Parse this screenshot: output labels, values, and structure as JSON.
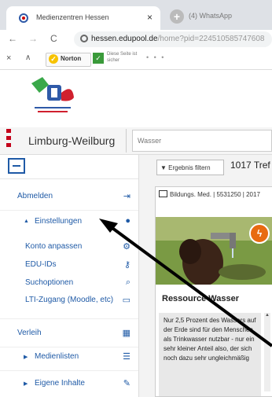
{
  "browser": {
    "tab_title": "Medienzentren Hessen",
    "tab_close": "×",
    "tab2_title": "(4) WhatsApp",
    "url_host": "hessen.edupool.de",
    "url_path": "/home?pid=224510585747608",
    "nav_back": "←",
    "nav_forward": "→",
    "nav_reload": "C"
  },
  "extensions": {
    "close": "×",
    "up": "∧",
    "norton_label": "Norton",
    "safeweb_text": "Diese Seite ist sicher",
    "dots": "• • •"
  },
  "header": {
    "region": "Limburg-Weilburg",
    "search_value": "Wasser"
  },
  "sidebar": {
    "items": [
      {
        "label": "Abmelden",
        "icon": "logout-icon"
      },
      {
        "label": "Einstellungen",
        "icon": "user-icon"
      },
      {
        "label": "Konto anpassen",
        "icon": "gear-icon"
      },
      {
        "label": "EDU-IDs",
        "icon": "key-icon"
      },
      {
        "label": "Suchoptionen",
        "icon": "search-icon"
      },
      {
        "label": "LTI-Zugang (Moodle, etc)",
        "icon": "monitor-icon"
      },
      {
        "label": "Verleih",
        "icon": "calendar-icon"
      },
      {
        "label": "Medienlisten",
        "icon": "list-icon"
      },
      {
        "label": "Eigene Inhalte",
        "icon": "edit-icon"
      }
    ]
  },
  "results": {
    "filter_label": "Ergebnis filtern",
    "hits": "1017 Tref",
    "card": {
      "meta": "Bildungs. Med. | 5531250 | 2017",
      "title": "Ressource Wasser",
      "description": "Nur 2,5 Prozent des Wassers auf der Erde sind für den Menschen als Trinkwasser nutzbar - nur ein sehr kleiner Anteil also, der sich noch dazu sehr ungleichmäßig"
    }
  }
}
